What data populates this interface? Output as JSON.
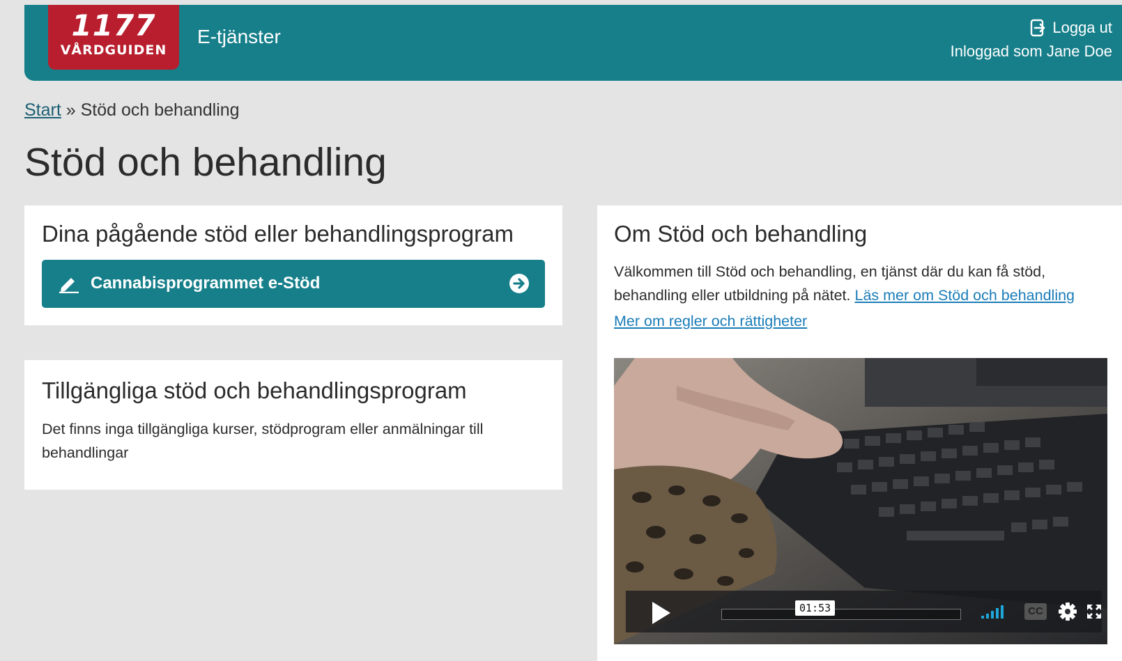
{
  "header": {
    "logo_number": "1177",
    "logo_text": "VÅRDGUIDEN",
    "service_title": "E-tjänster",
    "logout_label": "Logga ut",
    "logged_in_text": "Inloggad som Jane Doe",
    "brand_color": "#167f8a",
    "logo_color": "#b81e2e"
  },
  "breadcrumb": {
    "home_label": "Start",
    "separator": "»",
    "current": "Stöd och behandling"
  },
  "page_title": "Stöd och behandling",
  "ongoing": {
    "heading": "Dina pågående stöd eller behandlingsprogram",
    "programs": [
      {
        "label": "Cannabisprogrammet e-Stöd",
        "icon": "pencil-icon",
        "action_icon": "arrow-right-circle-icon"
      }
    ]
  },
  "available": {
    "heading": "Tillgängliga stöd och behandlingsprogram",
    "empty_text": "Det finns inga tillgängliga kurser, stödprogram eller anmälningar till behandlingar"
  },
  "about": {
    "heading": "Om Stöd och behandling",
    "intro": "Välkommen till Stöd och behandling, en tjänst där du kan få stöd, behandling eller utbildning på nätet.",
    "read_more_link": "Läs mer om Stöd och behandling",
    "rights_link": "Mer om regler och rättigheter",
    "link_color": "#1a7cb8"
  },
  "video": {
    "time_tooltip": "01:53",
    "cc_label": "CC",
    "controls": [
      "play-icon",
      "volume-icon",
      "cc-icon",
      "settings-icon",
      "fullscreen-icon"
    ]
  }
}
